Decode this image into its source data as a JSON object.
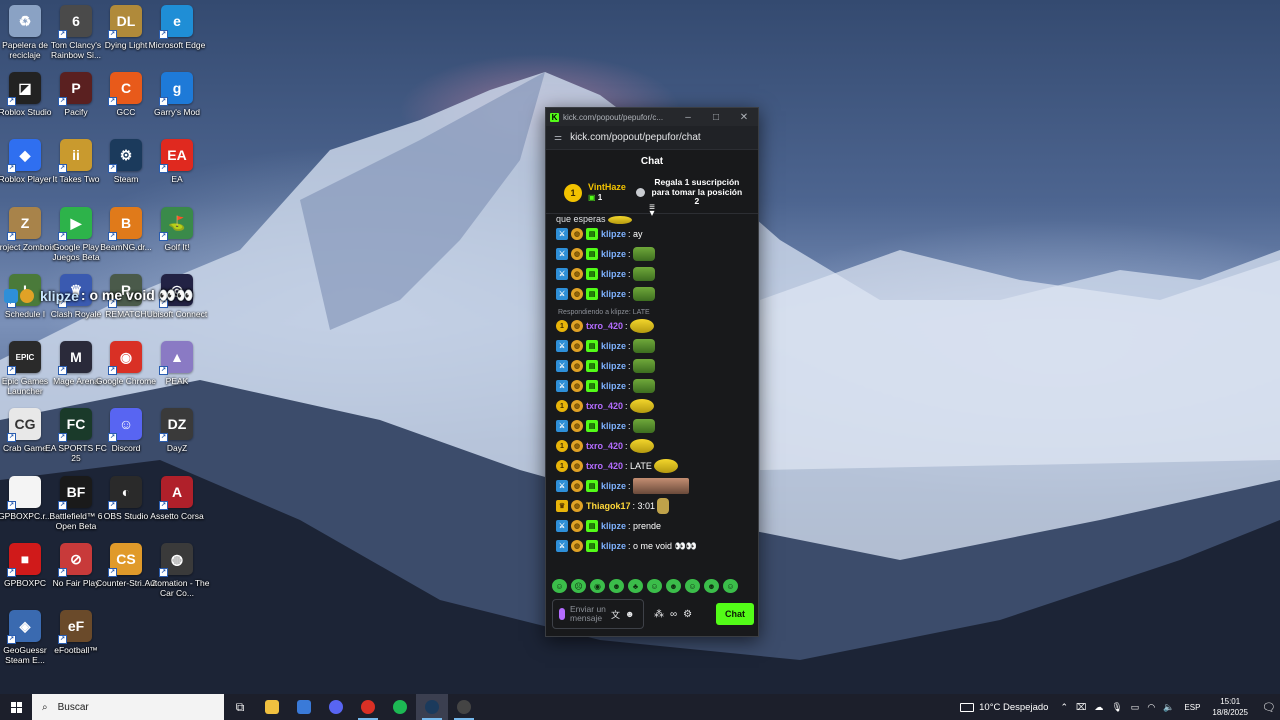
{
  "desktop": {
    "icons": [
      {
        "label": "Papelera de reciclaje",
        "icon": "recycle-bin-icon",
        "color": "#8aa2c4",
        "glyph": "♻"
      },
      {
        "label": "Tom Clancy's Rainbow Si...",
        "icon": "rainbow-six-icon",
        "color": "#4a4a4a",
        "glyph": "6"
      },
      {
        "label": "Dying Light",
        "icon": "dying-light-icon",
        "color": "#b08a3a",
        "glyph": "DL"
      },
      {
        "label": "Microsoft Edge",
        "icon": "edge-icon",
        "color": "#1f8ed6",
        "glyph": "e"
      },
      {
        "label": "Roblox Studio",
        "icon": "roblox-studio-icon",
        "color": "#222222",
        "glyph": "◪"
      },
      {
        "label": "Pacify",
        "icon": "pacify-icon",
        "color": "#5a2020",
        "glyph": "P"
      },
      {
        "label": "GCC",
        "icon": "gcc-icon",
        "color": "#e85a1a",
        "glyph": "C"
      },
      {
        "label": "Garry's Mod",
        "icon": "garrys-mod-icon",
        "color": "#1e7ad8",
        "glyph": "g"
      },
      {
        "label": "Roblox Player",
        "icon": "roblox-player-icon",
        "color": "#2f6ff0",
        "glyph": "◆"
      },
      {
        "label": "It Takes Two",
        "icon": "it-takes-two-icon",
        "color": "#c99a2e",
        "glyph": "ii"
      },
      {
        "label": "Steam",
        "icon": "steam-icon",
        "color": "#1b3a5c",
        "glyph": "⚙"
      },
      {
        "label": "EA",
        "icon": "ea-icon",
        "color": "#e0291f",
        "glyph": "EA"
      },
      {
        "label": "Project Zomboid",
        "icon": "project-zomboid-icon",
        "color": "#a8834a",
        "glyph": "Z"
      },
      {
        "label": "Google Play Juegos Beta",
        "icon": "google-play-games-icon",
        "color": "#2db34a",
        "glyph": "▶"
      },
      {
        "label": "BeamNG.dr...",
        "icon": "beamng-icon",
        "color": "#e07a1a",
        "glyph": "B"
      },
      {
        "label": "Golf It!",
        "icon": "golf-it-icon",
        "color": "#3a8a4a",
        "glyph": "⛳"
      },
      {
        "label": "Schedule I",
        "icon": "schedule-one-icon",
        "color": "#4a7a3a",
        "glyph": "I"
      },
      {
        "label": "Clash Royale",
        "icon": "clash-royale-icon",
        "color": "#3a5ab0",
        "glyph": "♛"
      },
      {
        "label": "REMATCH",
        "icon": "rematch-icon",
        "color": "#4a5a4a",
        "glyph": "R"
      },
      {
        "label": "Ubisoft Connect",
        "icon": "ubisoft-connect-icon",
        "color": "#222244",
        "glyph": "◎"
      },
      {
        "label": "Epic Games Launcher",
        "icon": "epic-games-icon",
        "color": "#2a2a2a",
        "glyph": "EPIC"
      },
      {
        "label": "Mage Arena",
        "icon": "mage-arena-icon",
        "color": "#2a2a3a",
        "glyph": "M"
      },
      {
        "label": "Google Chrome",
        "icon": "chrome-icon",
        "color": "#d93025",
        "glyph": "◉"
      },
      {
        "label": "PEAK",
        "icon": "peak-icon",
        "color": "#8a7ac4",
        "glyph": "▲"
      },
      {
        "label": "Crab Game",
        "icon": "crab-game-icon",
        "color": "#e8e8e8",
        "glyph": "CG"
      },
      {
        "label": "EA SPORTS FC 25",
        "icon": "ea-fc25-icon",
        "color": "#1a3a2a",
        "glyph": "FC"
      },
      {
        "label": "Discord",
        "icon": "discord-icon",
        "color": "#5865f2",
        "glyph": "☺"
      },
      {
        "label": "DayZ",
        "icon": "dayz-icon",
        "color": "#3a3a3a",
        "glyph": "DZ"
      },
      {
        "label": "GPBOXPC.r...",
        "icon": "file-icon",
        "color": "#f4f4f4",
        "glyph": ""
      },
      {
        "label": "Battlefield™ 6 Open Beta",
        "icon": "battlefield-icon",
        "color": "#1a1a1a",
        "glyph": "BF"
      },
      {
        "label": "OBS Studio",
        "icon": "obs-icon",
        "color": "#2a2a2a",
        "glyph": "◐"
      },
      {
        "label": "Assetto Corsa",
        "icon": "assetto-corsa-icon",
        "color": "#b0202a",
        "glyph": "A"
      },
      {
        "label": "GPBOXPC",
        "icon": "gpboxpc-icon",
        "color": "#d01a1a",
        "glyph": "■"
      },
      {
        "label": "No Fair Play",
        "icon": "no-fair-play-icon",
        "color": "#c83a3a",
        "glyph": "⊘"
      },
      {
        "label": "Counter-Stri... 2",
        "icon": "counter-strike-icon",
        "color": "#e09a2a",
        "glyph": "CS"
      },
      {
        "label": "Automation - The Car Co...",
        "icon": "automation-icon",
        "color": "#3a3a3a",
        "glyph": "◍"
      },
      {
        "label": "GeoGuessr Steam E...",
        "icon": "geoguessr-icon",
        "color": "#3a6ab0",
        "glyph": "◈"
      },
      {
        "label": "eFootball™",
        "icon": "efootball-icon",
        "color": "#6a4a2a",
        "glyph": "eF"
      }
    ]
  },
  "overlay": {
    "user": "klipze",
    "text": ": o me void 👀👀"
  },
  "popup": {
    "window_title": "kick.com/popout/pepufor/c...",
    "url": "kick.com/popout/pepufor/chat",
    "header": "Chat",
    "gift": {
      "rank": "1",
      "user": "VintHaze",
      "count": "1",
      "cta": "Regala 1 suscripción para tomar la posición 2"
    },
    "partial_message": "que esperas",
    "reply_label": "Respondiendo a klipze: LATE",
    "messages": [
      {
        "badges": [
          "mod",
          "coin",
          "sub"
        ],
        "user": "klipze",
        "color": "blue",
        "text": ": ay",
        "emote": ""
      },
      {
        "badges": [
          "mod",
          "coin",
          "sub"
        ],
        "user": "klipze",
        "color": "blue",
        "text": ":",
        "emote": "frog"
      },
      {
        "badges": [
          "mod",
          "coin",
          "sub"
        ],
        "user": "klipze",
        "color": "blue",
        "text": ":",
        "emote": "frog"
      },
      {
        "badges": [
          "mod",
          "coin",
          "sub"
        ],
        "user": "klipze",
        "color": "blue",
        "text": ":",
        "emote": "frog"
      },
      {
        "reply": true
      },
      {
        "badges": [
          "gold",
          "coin"
        ],
        "user": "txro_420",
        "color": "purple",
        "text": ":",
        "emote": "minion"
      },
      {
        "badges": [
          "mod",
          "coin",
          "sub"
        ],
        "user": "klipze",
        "color": "blue",
        "text": ":",
        "emote": "frog"
      },
      {
        "badges": [
          "mod",
          "coin",
          "sub"
        ],
        "user": "klipze",
        "color": "blue",
        "text": ":",
        "emote": "frog"
      },
      {
        "badges": [
          "mod",
          "coin",
          "sub"
        ],
        "user": "klipze",
        "color": "blue",
        "text": ":",
        "emote": "frog"
      },
      {
        "badges": [
          "gold",
          "coin"
        ],
        "user": "txro_420",
        "color": "purple",
        "text": ":",
        "emote": "minion"
      },
      {
        "badges": [
          "mod",
          "coin",
          "sub"
        ],
        "user": "klipze",
        "color": "blue",
        "text": ":",
        "emote": "frog"
      },
      {
        "badges": [
          "gold",
          "coin"
        ],
        "user": "txro_420",
        "color": "purple",
        "text": ":",
        "emote": "minion"
      },
      {
        "badges": [
          "gold",
          "coin"
        ],
        "user": "txro_420",
        "color": "purple",
        "text": ": LATE",
        "emote": "minion"
      },
      {
        "badges": [
          "mod",
          "coin",
          "sub"
        ],
        "user": "klipze",
        "color": "blue",
        "text": ":",
        "emote": "face"
      },
      {
        "badges": [
          "crown",
          "coin"
        ],
        "user": "Thiagok17",
        "color": "yellow",
        "text": ": 3:01",
        "emote": "mini"
      },
      {
        "badges": [
          "mod",
          "coin",
          "sub"
        ],
        "user": "klipze",
        "color": "blue",
        "text": ": prende",
        "emote": ""
      },
      {
        "badges": [
          "mod",
          "coin",
          "sub"
        ],
        "user": "klipze",
        "color": "blue",
        "text": ": o me void 👀👀",
        "emote": ""
      }
    ],
    "input_placeholder": "Enviar un mensaje",
    "chat_button": "Chat"
  },
  "taskbar": {
    "search_placeholder": "Buscar",
    "apps": [
      "task-view-icon",
      "file-explorer-icon",
      "store-icon",
      "discord-icon",
      "chrome-icon",
      "spotify-icon",
      "steam-icon",
      "obs-icon"
    ],
    "weather": "10°C  Despejado",
    "language": "ESP",
    "time": "15:01",
    "date": "18/8/2025"
  },
  "colors": {
    "kick_green": "#53fc18",
    "mod_blue": "#2e8fd8",
    "taskbar": "#1c1f2b"
  }
}
